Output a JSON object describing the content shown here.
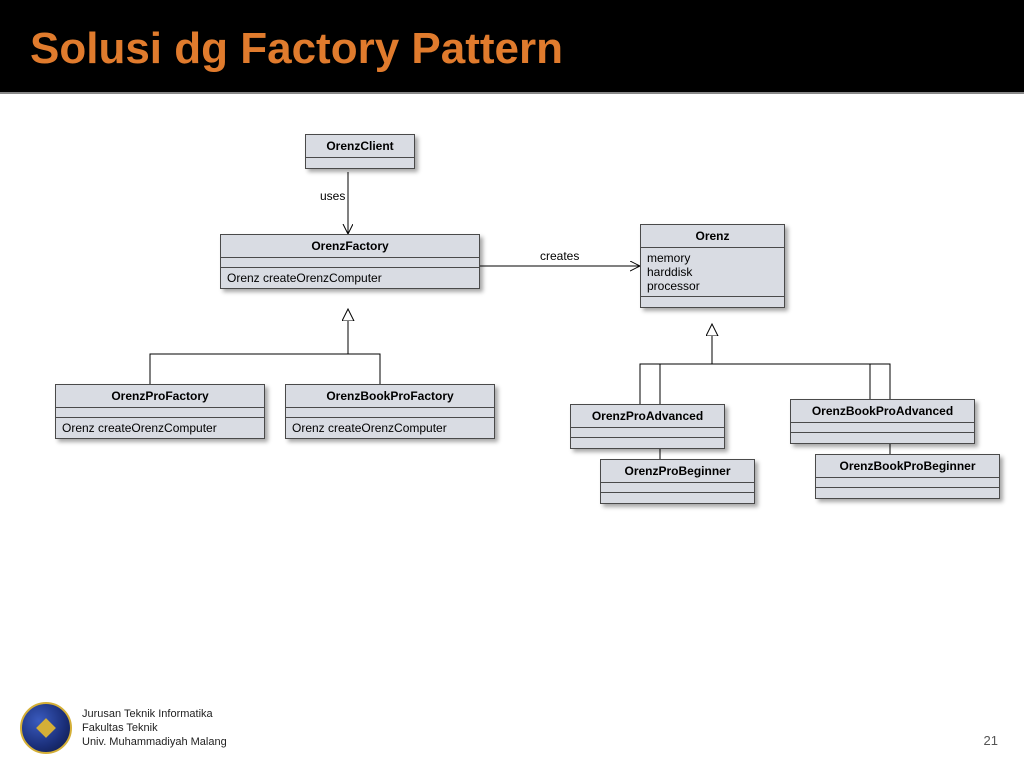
{
  "slide": {
    "title": "Solusi dg Factory Pattern",
    "page_number": "21"
  },
  "labels": {
    "uses": "uses",
    "creates": "creates"
  },
  "classes": {
    "client": {
      "name": "OrenzClient"
    },
    "factory": {
      "name": "OrenzFactory",
      "op": "Orenz createOrenzComputer"
    },
    "proFactory": {
      "name": "OrenzProFactory",
      "op": "Orenz createOrenzComputer"
    },
    "bookProFactory": {
      "name": "OrenzBookProFactory",
      "op": "Orenz createOrenzComputer"
    },
    "orenz": {
      "name": "Orenz",
      "attrs": [
        "memory",
        "harddisk",
        "processor"
      ]
    },
    "proAdvanced": {
      "name": "OrenzProAdvanced"
    },
    "proBeginner": {
      "name": "OrenzProBeginner"
    },
    "bookProAdvanced": {
      "name": "OrenzBookProAdvanced"
    },
    "bookProBeginner": {
      "name": "OrenzBookProBeginner"
    }
  },
  "footer": {
    "line1": "Jurusan Teknik Informatika",
    "line2": "Fakultas Teknik",
    "line3": "Univ. Muhammadiyah Malang"
  }
}
